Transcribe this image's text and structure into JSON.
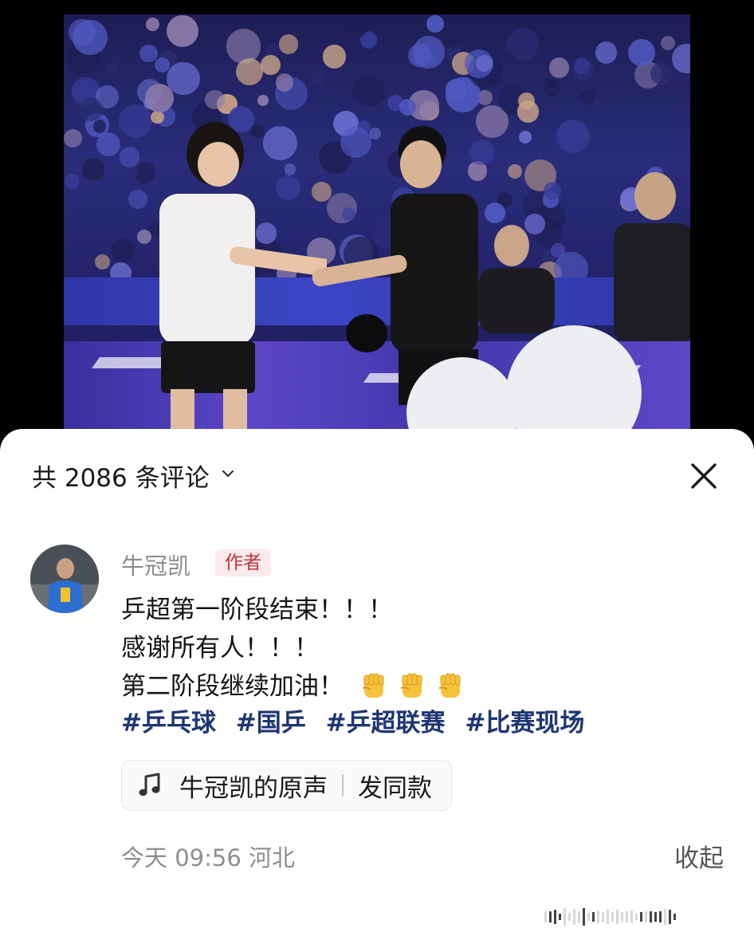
{
  "video": {
    "description_icon": "table-tennis-match-photo"
  },
  "sheet": {
    "comment_count_label": "共 2086 条评论",
    "chevron_icon": "chevron-down-icon",
    "close_icon": "close-icon"
  },
  "comment": {
    "username": "牛冠凯",
    "author_badge": "作者",
    "lines": [
      "乒超第一阶段结束！！！",
      "感谢所有人！！！",
      "第二阶段继续加油！"
    ],
    "emoji": "fist-emoji",
    "hashtags": [
      "#乒乓球",
      "#国乒",
      "#乒超联赛",
      "#比赛现场"
    ],
    "sound": {
      "icon": "music-note-icon",
      "label": "牛冠凯的原声",
      "action": "发同款"
    },
    "meta": "今天 09:56 河北",
    "collapse_label": "收起"
  },
  "colors": {
    "author_badge_text": "#c5343d",
    "author_badge_bg": "#fbeaec",
    "hashtag": "#1d3572",
    "meta": "#8e8e8e"
  }
}
